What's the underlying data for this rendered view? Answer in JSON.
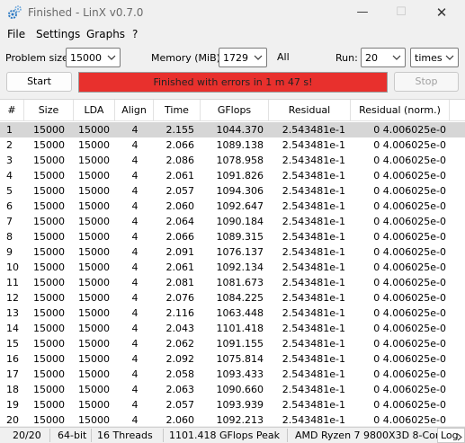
{
  "window": {
    "title": "Finished - LinX v0.7.0",
    "minimize_glyph": "—",
    "maximize_glyph": "☐",
    "close_glyph": "✕"
  },
  "menu": [
    "File",
    "Settings",
    "Graphs",
    "?"
  ],
  "toolbar": {
    "problem_size_label": "Problem size:",
    "problem_size_value": "15000",
    "memory_label": "Memory (MiB):",
    "memory_value": "1729",
    "all_label": "All",
    "run_label": "Run:",
    "run_value": "20",
    "times_value": "times",
    "start_label": "Start",
    "stop_label": "Stop",
    "progress_text": "Finished with errors in 1 m 47 s!",
    "progress_fraction": 1.0,
    "progress_color": "#e8302d"
  },
  "table": {
    "headers": [
      "#",
      "Size",
      "LDA",
      "Align",
      "Time",
      "GFlops",
      "Residual",
      "Residual (norm.)"
    ],
    "rows": [
      [
        "1",
        "15000",
        "15000",
        "4",
        "2.155",
        "1044.370",
        "2.543481e-1",
        "0 4.006025e-0"
      ],
      [
        "2",
        "15000",
        "15000",
        "4",
        "2.066",
        "1089.138",
        "2.543481e-1",
        "0 4.006025e-0"
      ],
      [
        "3",
        "15000",
        "15000",
        "4",
        "2.086",
        "1078.958",
        "2.543481e-1",
        "0 4.006025e-0"
      ],
      [
        "4",
        "15000",
        "15000",
        "4",
        "2.061",
        "1091.826",
        "2.543481e-1",
        "0 4.006025e-0"
      ],
      [
        "5",
        "15000",
        "15000",
        "4",
        "2.057",
        "1094.306",
        "2.543481e-1",
        "0 4.006025e-0"
      ],
      [
        "6",
        "15000",
        "15000",
        "4",
        "2.060",
        "1092.647",
        "2.543481e-1",
        "0 4.006025e-0"
      ],
      [
        "7",
        "15000",
        "15000",
        "4",
        "2.064",
        "1090.184",
        "2.543481e-1",
        "0 4.006025e-0"
      ],
      [
        "8",
        "15000",
        "15000",
        "4",
        "2.066",
        "1089.315",
        "2.543481e-1",
        "0 4.006025e-0"
      ],
      [
        "9",
        "15000",
        "15000",
        "4",
        "2.091",
        "1076.137",
        "2.543481e-1",
        "0 4.006025e-0"
      ],
      [
        "10",
        "15000",
        "15000",
        "4",
        "2.061",
        "1092.134",
        "2.543481e-1",
        "0 4.006025e-0"
      ],
      [
        "11",
        "15000",
        "15000",
        "4",
        "2.081",
        "1081.673",
        "2.543481e-1",
        "0 4.006025e-0"
      ],
      [
        "12",
        "15000",
        "15000",
        "4",
        "2.076",
        "1084.225",
        "2.543481e-1",
        "0 4.006025e-0"
      ],
      [
        "13",
        "15000",
        "15000",
        "4",
        "2.116",
        "1063.448",
        "2.543481e-1",
        "0 4.006025e-0"
      ],
      [
        "14",
        "15000",
        "15000",
        "4",
        "2.043",
        "1101.418",
        "2.543481e-1",
        "0 4.006025e-0"
      ],
      [
        "15",
        "15000",
        "15000",
        "4",
        "2.062",
        "1091.155",
        "2.543481e-1",
        "0 4.006025e-0"
      ],
      [
        "16",
        "15000",
        "15000",
        "4",
        "2.092",
        "1075.814",
        "2.543481e-1",
        "0 4.006025e-0"
      ],
      [
        "17",
        "15000",
        "15000",
        "4",
        "2.058",
        "1093.433",
        "2.543481e-1",
        "0 4.006025e-0"
      ],
      [
        "18",
        "15000",
        "15000",
        "4",
        "2.063",
        "1090.660",
        "2.543481e-1",
        "0 4.006025e-0"
      ],
      [
        "19",
        "15000",
        "15000",
        "4",
        "2.057",
        "1093.939",
        "2.543481e-1",
        "0 4.006025e-0"
      ],
      [
        "20",
        "15000",
        "15000",
        "4",
        "2.060",
        "1092.213",
        "2.543481e-1",
        "0 4.006025e-0"
      ]
    ],
    "selected_row": 0
  },
  "status": {
    "progress": "20/20",
    "bits": "64-bit",
    "threads": "16 Threads",
    "peak": "1101.418 GFlops Peak",
    "cpu": "AMD Ryzen 7 9800X3D 8-Core",
    "log_label": "Log"
  },
  "icons": {
    "app": "gear-cluster-icon",
    "dropdown": "chevron-down-icon",
    "log_scroll": "chevron-right-icon"
  }
}
